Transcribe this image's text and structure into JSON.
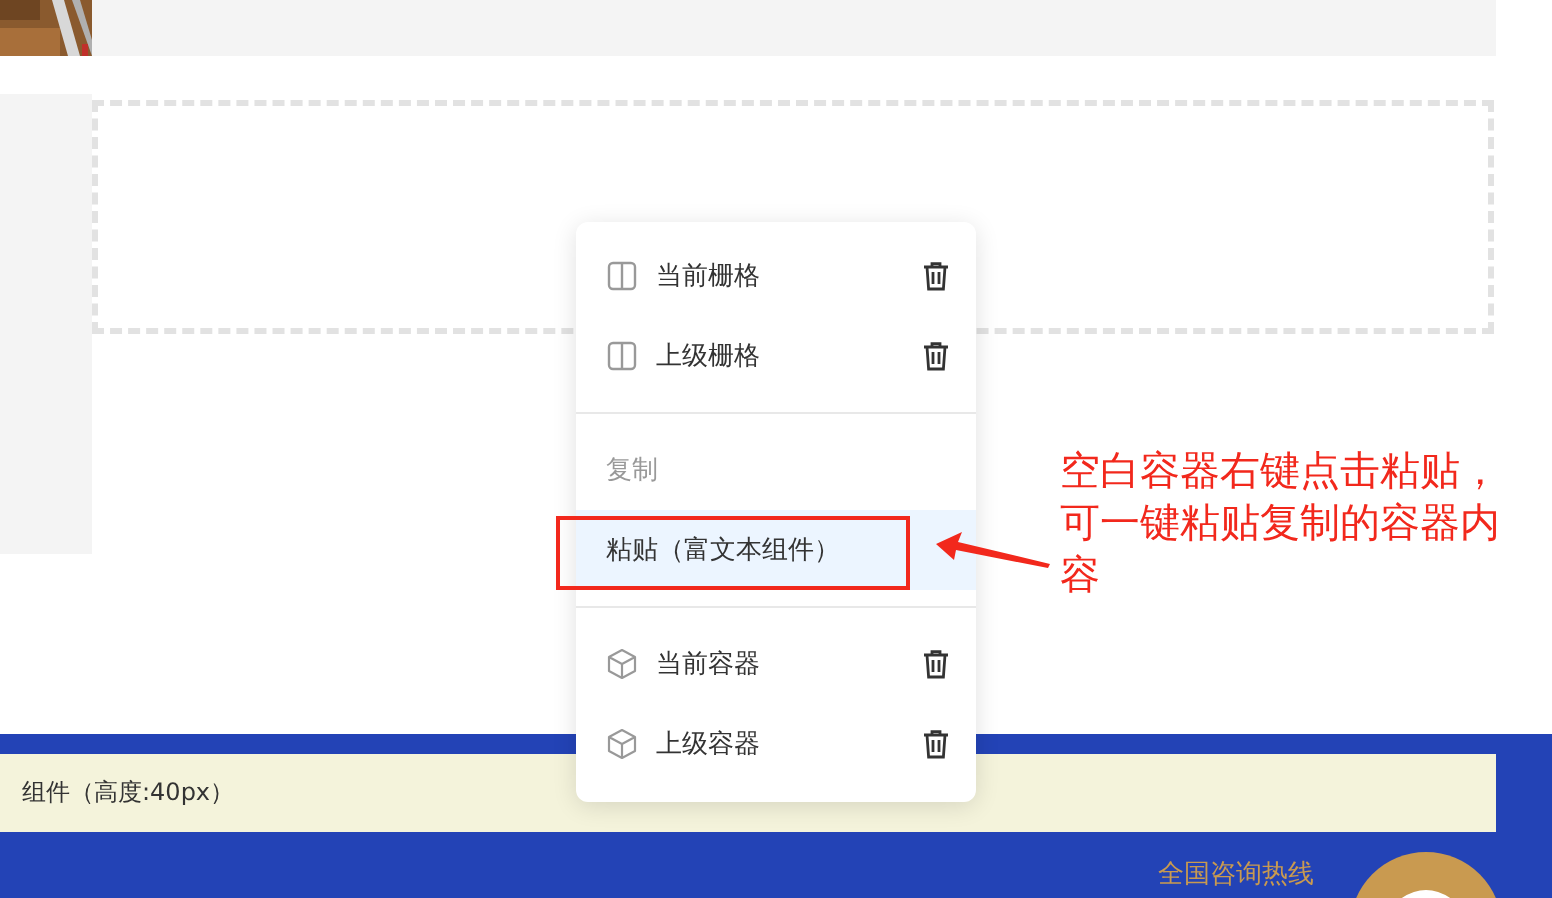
{
  "context_menu": {
    "sections": [
      {
        "items": [
          {
            "kind": "grid",
            "label": "当前栅格",
            "selected": false,
            "disabled": false
          },
          {
            "kind": "grid",
            "label": "上级栅格",
            "selected": false,
            "disabled": false
          }
        ]
      },
      {
        "items": [
          {
            "kind": "action",
            "label": "复制",
            "selected": false,
            "disabled": true
          },
          {
            "kind": "action",
            "label": "粘贴（富文本组件）",
            "selected": true,
            "disabled": false
          }
        ]
      },
      {
        "items": [
          {
            "kind": "container",
            "label": "当前容器",
            "selected": false,
            "disabled": false
          },
          {
            "kind": "container",
            "label": "上级容器",
            "selected": false,
            "disabled": false
          }
        ]
      }
    ]
  },
  "annotation": {
    "text": "空白容器右键点击粘贴，可一键粘贴复制的容器内容"
  },
  "footer": {
    "spacer_label": "组件（高度:40px）",
    "hotline_label": "全国咨询热线"
  }
}
